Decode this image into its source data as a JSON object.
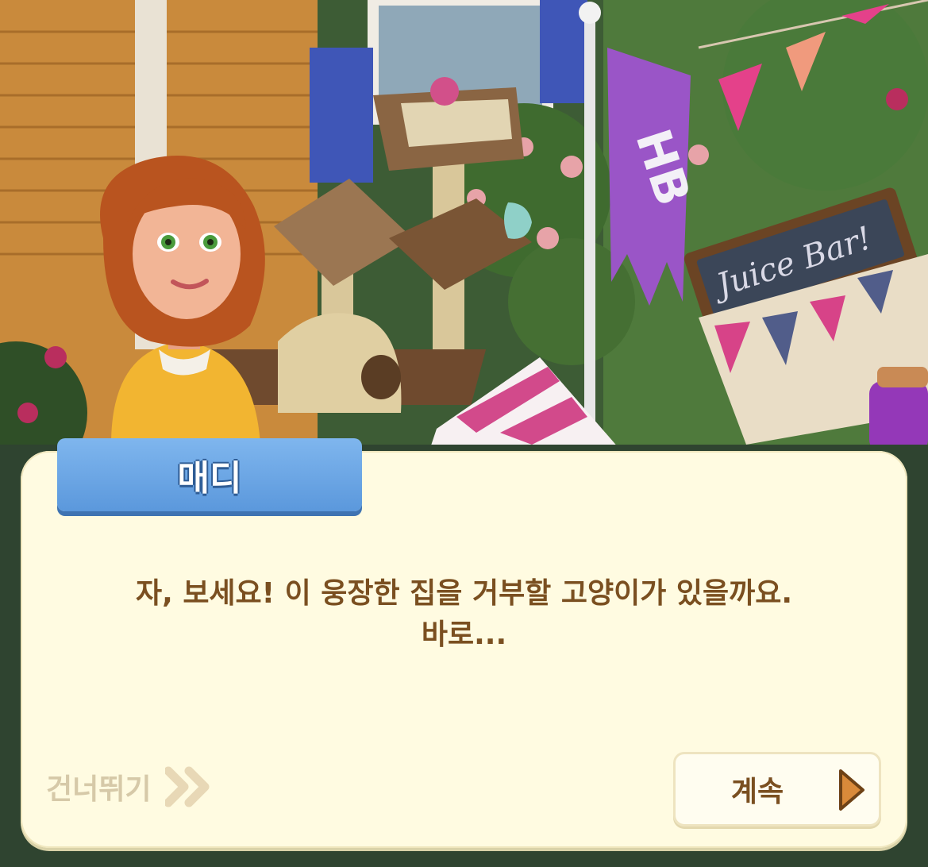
{
  "speaker": {
    "name": "매디"
  },
  "dialog": {
    "line1": "자, 보세요! 이 웅장한 집을 거부할 고양이가 있을까요.",
    "line2": "바로..."
  },
  "scene": {
    "banner_text": "HB",
    "sign_text": "Juice Bar!"
  },
  "controls": {
    "skip_label": "건너뛰기",
    "continue_label": "계속"
  },
  "icons": {
    "skip": "double-chevron-right-icon",
    "continue": "play-triangle-icon"
  },
  "colors": {
    "dialog_bg": "#fffbe1",
    "nameplate": "#5b98dc",
    "text": "#7a4f20",
    "skip_text": "#d6c9a8",
    "continue_arrow": "#d98a3a"
  }
}
